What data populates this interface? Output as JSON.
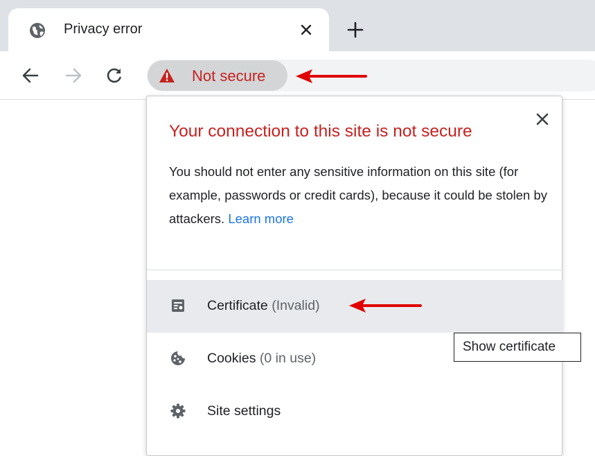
{
  "tab": {
    "title": "Privacy error",
    "favicon": "globe-icon"
  },
  "toolbar": {
    "back": "arrow-left-icon",
    "forward": "arrow-right-icon",
    "reload": "reload-icon",
    "security_chip": {
      "label": "Not secure",
      "icon": "warning-triangle-icon"
    }
  },
  "popup": {
    "title": "Your connection to this site is not secure",
    "body": "You should not enter any sensitive information on this site (for example, passwords or credit cards), because it could be stolen by attackers.",
    "learn_more": "Learn more",
    "items": [
      {
        "label": "Certificate",
        "sub": "(Invalid)",
        "icon": "certificate-icon"
      },
      {
        "label": "Cookies",
        "sub": "(0 in use)",
        "icon": "cookie-icon"
      },
      {
        "label": "Site settings",
        "sub": "",
        "icon": "gear-icon"
      }
    ]
  },
  "tooltip": {
    "text": "Show certificate"
  },
  "colors": {
    "warning_red": "#c5221f",
    "annotation_arrow": "#e00000",
    "link_blue": "#1a73e8",
    "tabstrip_gray": "#dee1e6",
    "chip_gray": "#d3d5d7",
    "hover_row": "#e8eaed"
  }
}
